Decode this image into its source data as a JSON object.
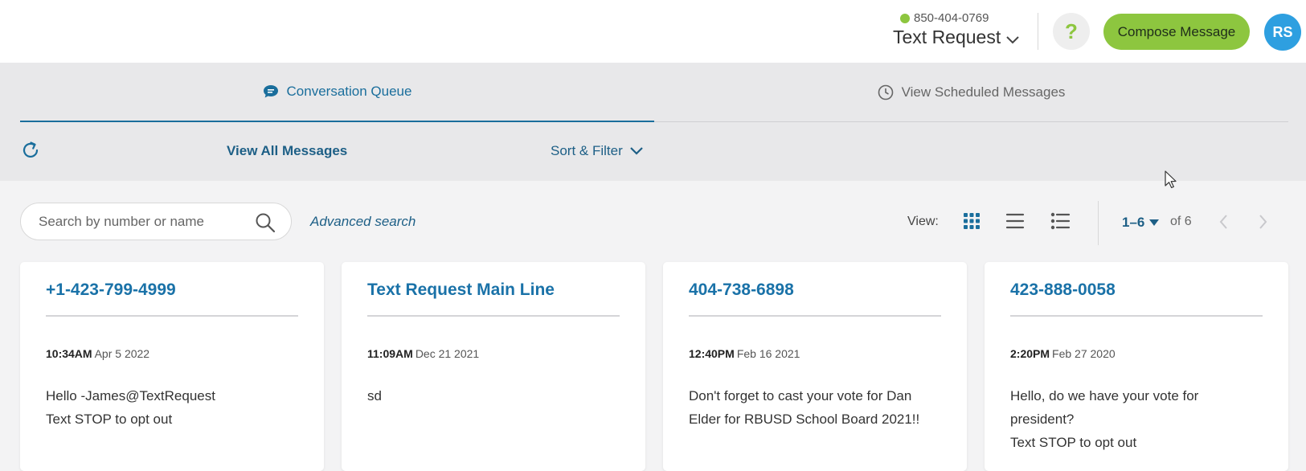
{
  "header": {
    "phone": "850-404-0769",
    "account_name": "Text Request",
    "help_label": "?",
    "compose_label": "Compose Message",
    "avatar_initials": "RS"
  },
  "tabs": [
    {
      "label": "Conversation Queue",
      "active": true
    },
    {
      "label": "View Scheduled Messages",
      "active": false
    }
  ],
  "toolbar": {
    "view_all_label": "View All Messages",
    "sort_filter_label": "Sort & Filter"
  },
  "search": {
    "placeholder": "Search by number or name",
    "value": "",
    "advanced_label": "Advanced search"
  },
  "view": {
    "label": "View:",
    "modes": [
      "grid-icon",
      "list-icon",
      "detailed-list-icon"
    ],
    "active_mode": "grid-icon"
  },
  "pagination": {
    "range": "1–6",
    "of_label": "of 6"
  },
  "cards": [
    {
      "title": "+1-423-799-4999",
      "time": "10:34AM",
      "date": "Apr 5 2022",
      "message_lines": [
        "Hello -James@TextRequest",
        "Text STOP to opt out"
      ]
    },
    {
      "title": "Text Request Main Line",
      "time": "11:09AM",
      "date": "Dec 21 2021",
      "message_lines": [
        "sd"
      ]
    },
    {
      "title": "404-738-6898",
      "time": "12:40PM",
      "date": "Feb 16 2021",
      "message_lines": [
        "Don't forget to cast your vote for Dan",
        "Elder for RBUSD School Board 2021!!"
      ]
    },
    {
      "title": "423-888-0058",
      "time": "2:20PM",
      "date": "Feb 27 2020",
      "message_lines": [
        "Hello, do we have your vote for",
        "president?",
        "Text STOP to opt out"
      ]
    }
  ],
  "colors": {
    "accent_blue": "#1a72a8",
    "brand_green": "#8dc63f",
    "avatar_blue": "#2e9fe0"
  }
}
